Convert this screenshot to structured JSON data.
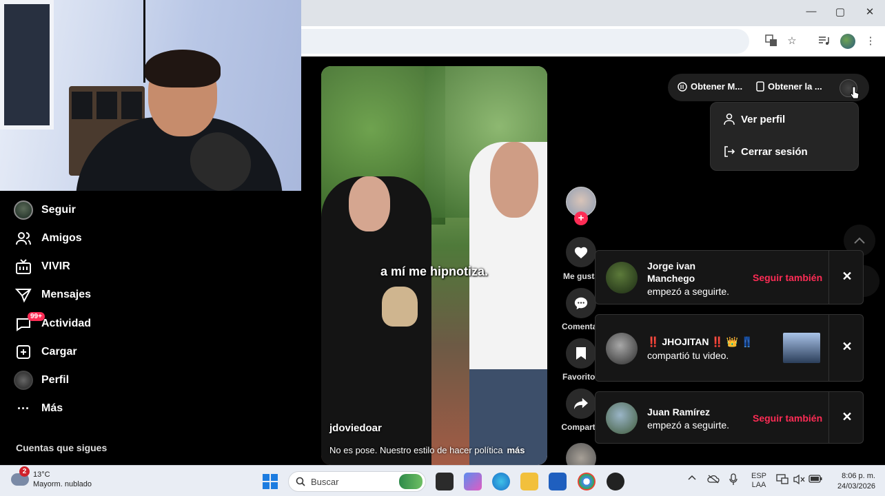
{
  "browser": {
    "window_controls": {
      "minimize": "—",
      "maximize": "▢",
      "close": "✕"
    }
  },
  "sidebar": {
    "items": [
      {
        "label": "Seguir",
        "icon": "following-avatar"
      },
      {
        "label": "Amigos",
        "icon": "friends-icon"
      },
      {
        "label": "VIVIR",
        "icon": "live-tv-icon"
      },
      {
        "label": "Mensajes",
        "icon": "messages-icon"
      },
      {
        "label": "Actividad",
        "icon": "activity-icon",
        "badge": "99+"
      },
      {
        "label": "Cargar",
        "icon": "upload-icon"
      },
      {
        "label": "Perfil",
        "icon": "profile-avatar"
      },
      {
        "label": "Más",
        "icon": "more-icon"
      }
    ],
    "following_title": "Cuentas que sigues"
  },
  "video": {
    "overlay_caption": "a mí me hipnotiza.",
    "username": "jdoviedoar",
    "description": "No es pose. Nuestro estilo de hacer política",
    "more_label": "más"
  },
  "actions": {
    "like_label": "Me gusta",
    "comment_label": "Comentar",
    "favorite_label": "Favoritos",
    "share_label": "Compartir"
  },
  "header": {
    "get_app_label": "Obtener M...",
    "get_app2_label": "Obtener la ..."
  },
  "profile_menu": {
    "view_profile": "Ver perfil",
    "logout": "Cerrar sesión"
  },
  "notifications": [
    {
      "name": "Jorge ivan Manchego",
      "message": "empezó a seguirte.",
      "action": "Seguir también"
    },
    {
      "name": "‼️ JHOJITAN ‼️ 👑 👖",
      "message": "compartió tu video."
    },
    {
      "name": "Juan Ramírez",
      "message": "empezó a seguirte.",
      "action": "Seguir también"
    }
  ],
  "notification_close": "✕",
  "taskbar": {
    "weather_badge": "2",
    "temperature": "13°C",
    "weather_desc": "Mayorm. nublado",
    "search_label": "Buscar",
    "lang_top": "ESP",
    "lang_bottom": "LAA",
    "time": "8:06 p. m.",
    "date": "24/03/2026"
  },
  "colors": {
    "accent": "#fe2c55",
    "background": "#000000",
    "panel": "#161616"
  }
}
